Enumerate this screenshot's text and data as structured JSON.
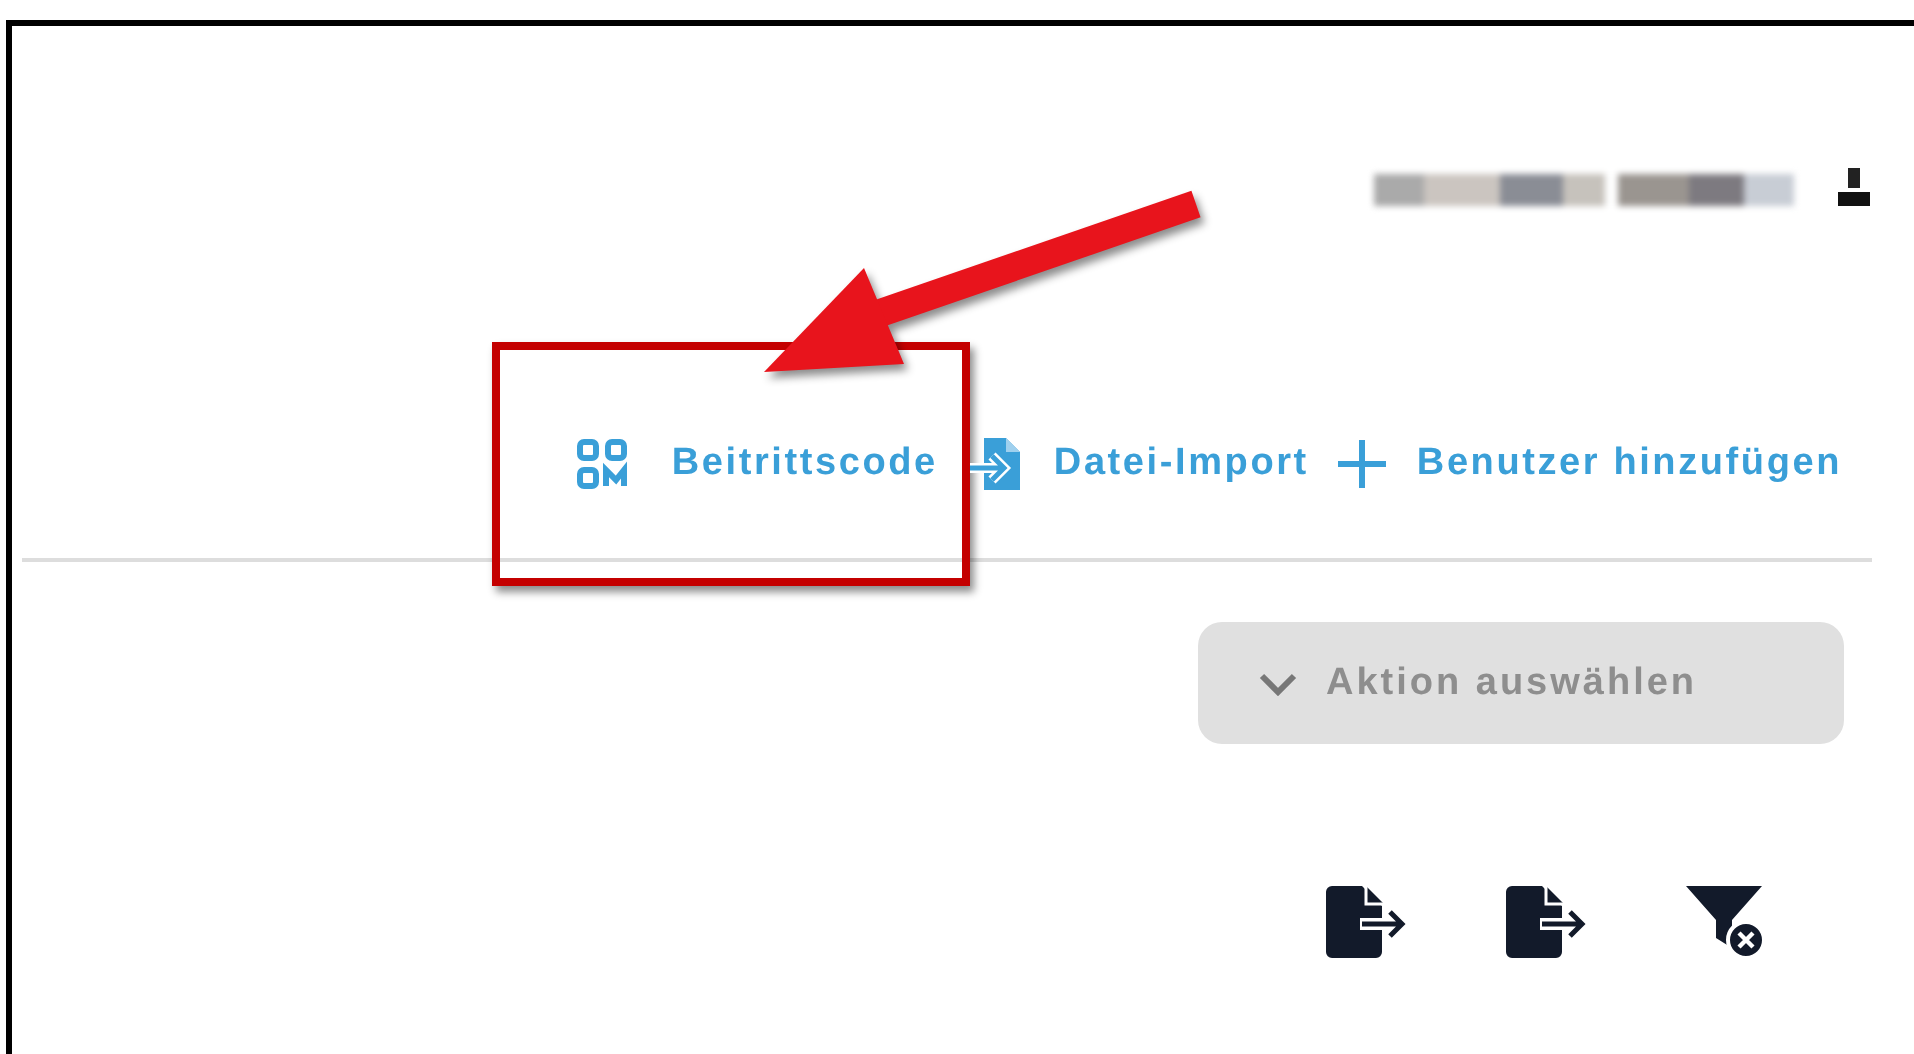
{
  "user": {
    "redacted": true
  },
  "toolbar": [
    {
      "kind": "qr",
      "label": "Beitrittscode",
      "highlighted": true
    },
    {
      "kind": "import",
      "label": "Datei-Import",
      "highlighted": false
    },
    {
      "kind": "add",
      "label": "Benutzer hinzufügen",
      "highlighted": false
    }
  ],
  "action_select": {
    "label": "Aktion auswählen"
  }
}
